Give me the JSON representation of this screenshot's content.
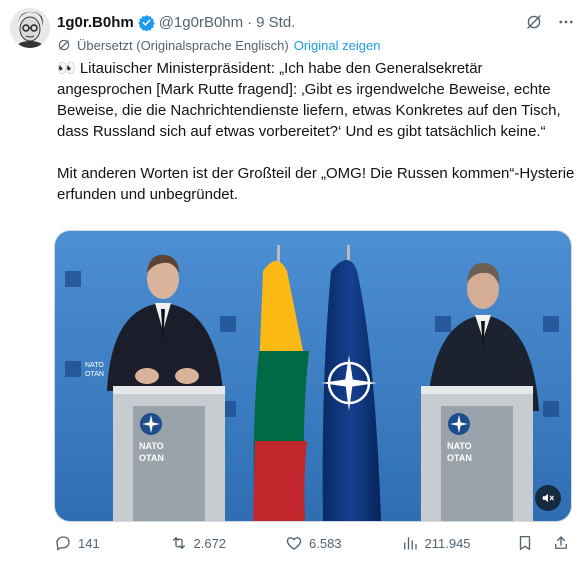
{
  "tweet": {
    "display_name": "1g0r.B0hm",
    "handle": "@1g0rB0hm",
    "separator": "·",
    "time": "9 Std.",
    "translation_note": "Übersetzt (Originalsprache Englisch)",
    "show_original": "Original zeigen",
    "paragraph1": "👀 Litauischer Ministerpräsident: „Ich habe den Generalsekretär angesprochen [Mark Rutte fragend]: ‚Gibt es irgendwelche Beweise, echte Beweise, die die Nachrichtendienste liefern, etwas Konkretes auf den Tisch, dass Russland sich auf etwas vorbereitet?‘ Und es gibt tatsächlich keine.“",
    "paragraph2": "Mit anderen Worten ist der Großteil der „OMG! Die Russen kommen“-Hysterie erfunden und unbegründet."
  },
  "media": {
    "podium_label_1": "NATO",
    "podium_label_2": "OTAN",
    "backdrop_label_1": "NATO",
    "backdrop_label_2": "OTAN"
  },
  "stats": {
    "replies": "141",
    "reposts": "2.672",
    "likes": "6.583",
    "views": "211.945"
  },
  "colors": {
    "accent": "#1d9bf0",
    "text_secondary": "#536471",
    "backdrop_blue": "#3f7fc4",
    "nato_flag": "#0b2e6f",
    "lithuania_yellow": "#fdb913",
    "lithuania_green": "#006a44",
    "lithuania_red": "#c1272d"
  }
}
